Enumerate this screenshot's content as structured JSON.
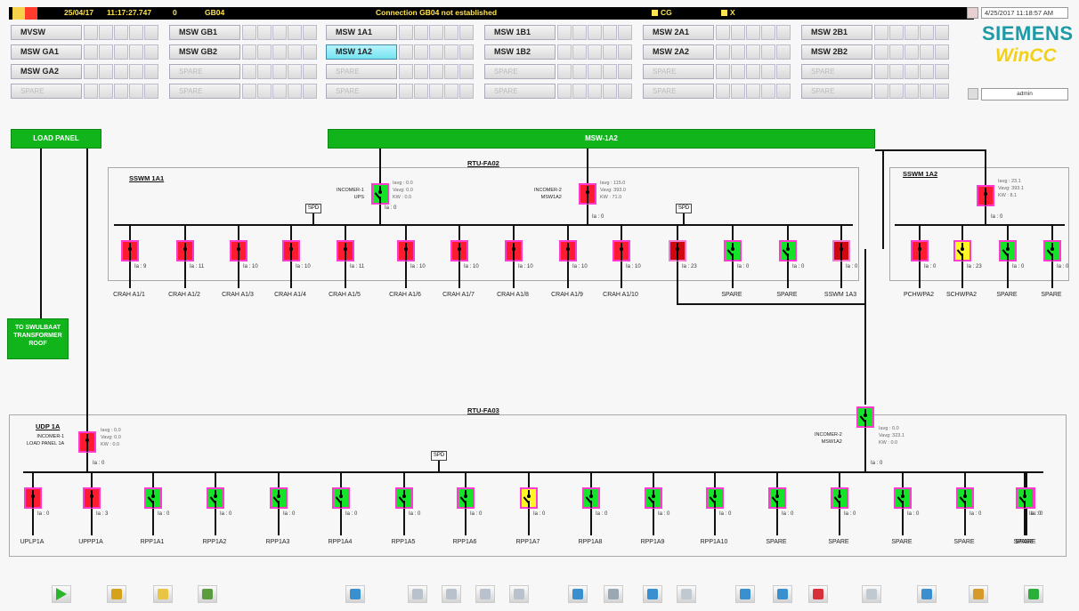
{
  "topbar": {
    "date": "25/04/17",
    "time": "11:17:27.747",
    "count": "0",
    "station": "GB04",
    "message": "Connection GB04 not established",
    "flag1": "CG",
    "flag2": "X"
  },
  "clock": "4/25/2017 11:18:57 AM",
  "brand": {
    "line1": "SIEMENS",
    "line2": "WinCC"
  },
  "user": "admin",
  "nav": {
    "rows": [
      [
        "MVSW",
        "MSW GB1",
        "MSW 1A1",
        "MSW 1B1",
        "MSW 2A1",
        "MSW 2B1"
      ],
      [
        "MSW GA1",
        "MSW GB2",
        "MSW 1A2",
        "MSW 1B2",
        "MSW 2A2",
        "MSW 2B2"
      ],
      [
        "MSW GA2",
        "SPARE",
        "SPARE",
        "SPARE",
        "SPARE",
        "SPARE"
      ],
      [
        "SPARE",
        "SPARE",
        "SPARE",
        "SPARE",
        "SPARE",
        "SPARE"
      ]
    ],
    "selected": "MSW 1A2"
  },
  "diagram": {
    "load_panel": "LOAD PANEL",
    "bus_main": "MSW-1A2",
    "to_roof": "TO SWULBAAT TRANSFORMER ROOF",
    "rtu1": "RTU-FA02",
    "rtu2": "RTU-FA03",
    "panel1": "SSWM 1A1",
    "panel2": "SSWM 1A2",
    "panel3": "UDP 1A",
    "spd": "SPD",
    "incomer1": {
      "label": "INCOMER-1\nUPS",
      "meas": "Iavg : 0.0\nVavg: 0.0\nKW : 0.0",
      "ia": "Ia : 0"
    },
    "incomer2": {
      "label": "INCOMER-2\nMSW1A2",
      "meas": "Iavg : 115.0\nVavg: 393.0\nKW : 71.0",
      "ia": "Ia : 0"
    },
    "incomer_1a2": {
      "meas": "Iavg : 23.1\nVavg: 393.1\nKW : 8.1",
      "ia": "Ia : 0"
    },
    "incomer_udp1": {
      "label": "INCOMER-1\nLOAD PANEL 1A",
      "meas": "Iavg : 0.0\nVavg: 0.0\nKW : 0.0",
      "ia": "Ia : 0"
    },
    "incomer_udp2": {
      "label": "INCOMER-2\nMSW1A2",
      "meas": "Iavg : 0.0\nVavg: 323.1\nKW : 0.0",
      "ia": "Ia : 0"
    },
    "feeders1": [
      {
        "name": "CRAH A1/1",
        "ia": "Ia : 9",
        "state": "off"
      },
      {
        "name": "CRAH A1/2",
        "ia": "Ia : 11",
        "state": "off"
      },
      {
        "name": "CRAH A1/3",
        "ia": "Ia : 10",
        "state": "off"
      },
      {
        "name": "CRAH A1/4",
        "ia": "Ia : 10",
        "state": "off"
      },
      {
        "name": "CRAH A1/5",
        "ia": "Ia : 11",
        "state": "off"
      },
      {
        "name": "CRAH A1/6",
        "ia": "Ia : 10",
        "state": "off"
      },
      {
        "name": "CRAH A1/7",
        "ia": "Ia : 10",
        "state": "off"
      },
      {
        "name": "CRAH A1/8",
        "ia": "Ia : 10",
        "state": "off"
      },
      {
        "name": "CRAH A1/9",
        "ia": "Ia : 10",
        "state": "off"
      },
      {
        "name": "CRAH A1/10",
        "ia": "Ia : 10",
        "state": "off"
      },
      {
        "name": "",
        "ia": "Ia : 23",
        "state": "dk"
      },
      {
        "name": "SPARE",
        "ia": "Ia : 0",
        "state": "on"
      },
      {
        "name": "SPARE",
        "ia": "Ia : 0",
        "state": "on"
      },
      {
        "name": "SSWM 1A3",
        "ia": "Ia : 0",
        "state": "dk"
      }
    ],
    "feeders2": [
      {
        "name": "PCHWPA2",
        "ia": "Ia : 0",
        "state": "off"
      },
      {
        "name": "SCHWPA2",
        "ia": "Ia : 23",
        "state": "tr"
      },
      {
        "name": "SPARE",
        "ia": "Ia : 0",
        "state": "on"
      },
      {
        "name": "SPARE",
        "ia": "Ia : 0",
        "state": "on"
      }
    ],
    "feeders3": [
      {
        "name": "UPLP1A",
        "ia": "Ia : 0",
        "state": "off"
      },
      {
        "name": "UPPP1A",
        "ia": "Ia : 3",
        "state": "off"
      },
      {
        "name": "RPP1A1",
        "ia": "Ia : 0",
        "state": "on"
      },
      {
        "name": "RPP1A2",
        "ia": "Ia : 0",
        "state": "on"
      },
      {
        "name": "RPP1A3",
        "ia": "Ia : 0",
        "state": "on"
      },
      {
        "name": "RPP1A4",
        "ia": "Ia : 0",
        "state": "on"
      },
      {
        "name": "RPP1A5",
        "ia": "Ia : 0",
        "state": "on"
      },
      {
        "name": "RPP1A6",
        "ia": "Ia : 0",
        "state": "on"
      },
      {
        "name": "RPP1A7",
        "ia": "Ia : 0",
        "state": "tr"
      },
      {
        "name": "RPP1A8",
        "ia": "Ia : 0",
        "state": "on"
      },
      {
        "name": "RPP1A9",
        "ia": "Ia : 0",
        "state": "on"
      },
      {
        "name": "RPP1A10",
        "ia": "Ia : 0",
        "state": "on"
      },
      {
        "name": "SPARE",
        "ia": "Ia : 0",
        "state": "on"
      },
      {
        "name": "SPARE",
        "ia": "Ia : 0",
        "state": "on"
      },
      {
        "name": "SPARE",
        "ia": "Ia : 0",
        "state": "on"
      },
      {
        "name": "SPARE",
        "ia": "Ia : 0",
        "state": "on"
      },
      {
        "name": "SPARE",
        "ia": "Ia : 0",
        "state": "on"
      },
      {
        "name": "SPARE",
        "ia": "Ia : 0",
        "state": "on"
      }
    ]
  },
  "toolbar": [
    {
      "name": "play-icon",
      "color": "#28b52a"
    },
    {
      "name": "key-icon",
      "color": "#d6a21e"
    },
    {
      "name": "folder-icon",
      "color": "#e8c544"
    },
    {
      "name": "report-icon",
      "color": "#5b9c3f"
    },
    {
      "name": "screen-select-icon",
      "color": "#3a8fcf"
    },
    {
      "name": "arrow-left-icon",
      "color": "#b9c2cc"
    },
    {
      "name": "arrow-up-icon",
      "color": "#b9c2cc"
    },
    {
      "name": "arrow-down-icon",
      "color": "#b9c2cc"
    },
    {
      "name": "arrow-right-icon",
      "color": "#b9c2cc"
    },
    {
      "name": "back-icon",
      "color": "#3a8fcf"
    },
    {
      "name": "forward-icon",
      "color": "#9aa8b2"
    },
    {
      "name": "alarm-list-icon",
      "color": "#3a8fcf"
    },
    {
      "name": "alarm-ack-icon",
      "color": "#c0c8d0"
    },
    {
      "name": "print-icon",
      "color": "#3a8fcf"
    },
    {
      "name": "save-icon",
      "color": "#3a8fcf"
    },
    {
      "name": "delete-icon",
      "color": "#d8303a"
    },
    {
      "name": "hardcopy-icon",
      "color": "#c0c8d0"
    },
    {
      "name": "help-icon",
      "color": "#3a8fcf"
    },
    {
      "name": "sound-icon",
      "color": "#d59a2a"
    },
    {
      "name": "exit-icon",
      "color": "#2cae3a"
    }
  ]
}
